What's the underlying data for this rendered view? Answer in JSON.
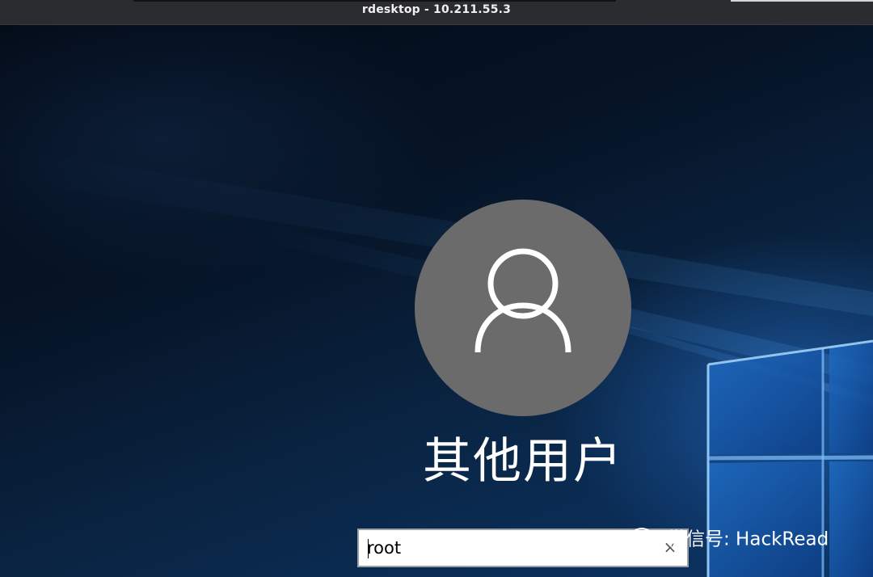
{
  "window": {
    "title": "rdesktop - 10.211.55.3"
  },
  "login": {
    "user_label": "其他用户",
    "username_value": "root",
    "clear_icon": "×"
  },
  "watermark": {
    "text": "微信号: HackRead",
    "icon": "wechat-logo-icon"
  },
  "colors": {
    "titlebar_bg": "#2b2c2f",
    "avatar_bg": "#6b6b6b",
    "desktop_dark": "#061426",
    "desktop_glow": "#2878dc"
  }
}
